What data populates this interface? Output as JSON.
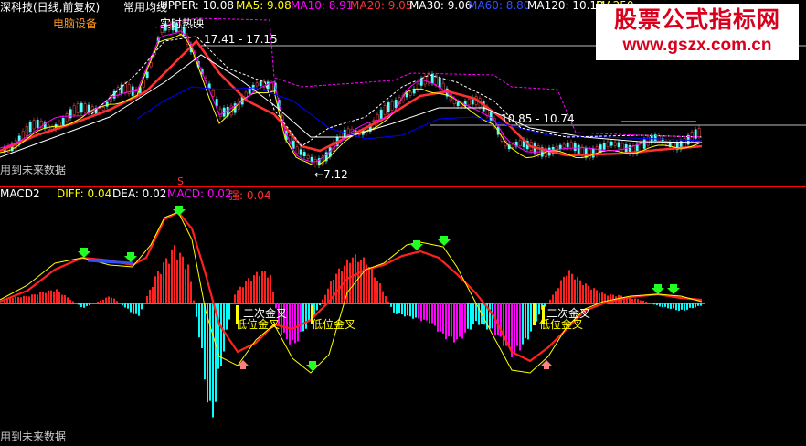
{
  "colors": {
    "background": "#000000",
    "divider": "#ff0000",
    "ma5": "#ffff00",
    "ma10": "#ff00ff",
    "ma20": "#ff3030",
    "ma30": "#ffffff",
    "ma60": "#0000ff",
    "ma120": "#ffffff",
    "diff": "#ffff00",
    "dea": "#ff2020",
    "macd_pos": "#ff2020",
    "macd_neg_cyan": "#00ffff",
    "macd_neg_magenta": "#ff00ff",
    "strength": "#ff3030",
    "upper_band": "#ff00ff",
    "watermark": "#d8001c"
  },
  "header": {
    "stock_name": "深科技(日线,前复权)",
    "indicator_name": "常用均线",
    "upper_label": "UPPER: 10.08",
    "ma5": "MA5: 9.08",
    "ma10": "MA10: 8.91",
    "ma20": "MA20: 9.05",
    "ma30": "MA30: 9.06",
    "ma60": "MA60: 8.80",
    "ma120": "MA120: 10.13",
    "ma250_partial": "MA250"
  },
  "annotations": {
    "sector": "电脑设备",
    "tag_top": "实时热映",
    "range_high": "17.41 - 17.15",
    "range_mid": "10.85 - 10.74",
    "low_price": "←7.12",
    "future_data_1": "用到未来数据",
    "future_data_2": "用到未来数据",
    "s_marker": "S",
    "golden_cross_2nd_1": "二次金叉",
    "golden_cross_2nd_2": "二次金叉",
    "low_golden_cross_1": "低位金叉",
    "low_golden_cross_2": "低位金叉",
    "low_golden_cross_3": "低位金叉"
  },
  "macd_header": {
    "name": "MACD2",
    "diff": "DIFF: 0.04",
    "dea": "DEA: 0.02",
    "macd": "MACD: 0.02",
    "strength": "强: 0.04"
  },
  "watermark": {
    "title": "股票公式指标网",
    "url": "www.gszx.com.cn"
  },
  "chart_data": [
    {
      "type": "line",
      "title": "常用均线",
      "series": [
        {
          "name": "MA5",
          "last": 9.08
        },
        {
          "name": "MA10",
          "last": 8.91
        },
        {
          "name": "MA20",
          "last": 9.05
        },
        {
          "name": "MA30",
          "last": 9.06
        },
        {
          "name": "MA60",
          "last": 8.8
        },
        {
          "name": "MA120",
          "last": 10.13
        },
        {
          "name": "UPPER",
          "last": 10.08
        }
      ],
      "price_labels": [
        17.41,
        17.15,
        10.85,
        10.74,
        7.12
      ],
      "grid": false
    },
    {
      "type": "bar",
      "title": "MACD2",
      "series": [
        {
          "name": "DIFF",
          "last": 0.04
        },
        {
          "name": "DEA",
          "last": 0.02
        },
        {
          "name": "MACD",
          "last": 0.02
        },
        {
          "name": "强",
          "last": 0.04
        }
      ],
      "grid": false
    }
  ]
}
